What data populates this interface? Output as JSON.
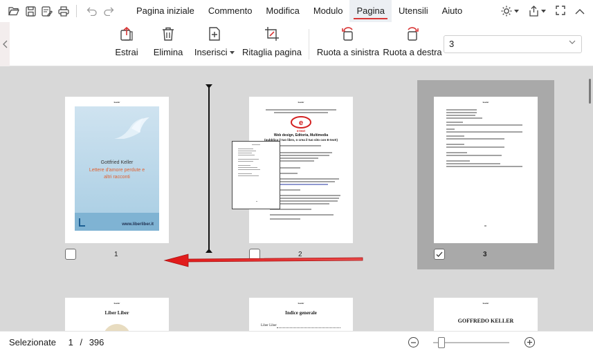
{
  "menubar": {
    "items": [
      "Pagina iniziale",
      "Commento",
      "Modifica",
      "Modulo",
      "Pagina",
      "Utensili",
      "Aiuto"
    ],
    "active_index": 4,
    "accent": "#d93636"
  },
  "ribbon": {
    "extract": "Estrai",
    "delete": "Elimina",
    "insert": "Inserisci",
    "crop": "Ritaglia pagina",
    "rotate_left": "Ruota a sinistra",
    "rotate_right": "Ruota a destra",
    "page_field": "3"
  },
  "thumbnails": [
    {
      "number": "1",
      "checked": false,
      "title": "Gottfried Keller",
      "subtitle": "Lettere d'amore perdute e altri racconti",
      "site": "www.liberliber.it"
    },
    {
      "number": "2",
      "checked": false,
      "logo": "e-text",
      "heading": "Web design, Editoria, Multimedia",
      "sub": "(pubblica il tuo libro, o crea il tuo sito con E-text!)"
    },
    {
      "number": "3",
      "checked": true
    }
  ],
  "lower_thumbs": [
    {
      "title": "Liber Liber"
    },
    {
      "title": "Indice generale",
      "line": "Liber Liber"
    },
    {
      "title": "GOFFREDO KELLER"
    }
  ],
  "status": {
    "label": "Selezionate",
    "current": "1",
    "separator": "/",
    "total": "396"
  },
  "colors": {
    "arrow": "#e02020",
    "selection": "#a9a9a9",
    "cover": "#9fc3db"
  }
}
